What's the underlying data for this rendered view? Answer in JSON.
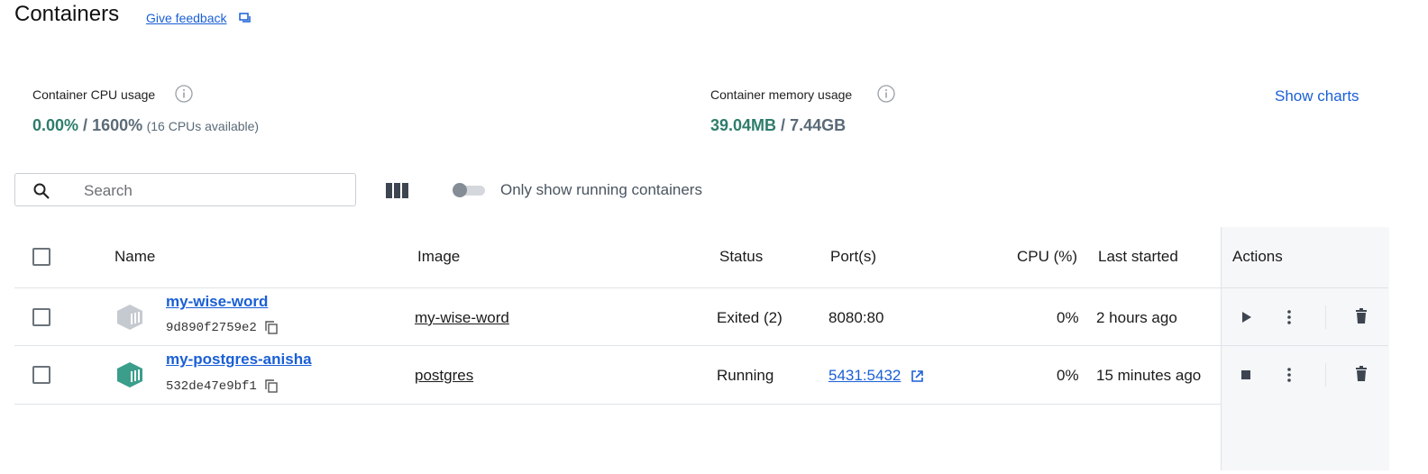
{
  "header": {
    "title": "Containers",
    "feedback_label": "Give feedback"
  },
  "stats": {
    "cpu": {
      "label": "Container CPU usage",
      "value": "0.00%",
      "separator": " / ",
      "total": "1600%",
      "note": "(16 CPUs available)"
    },
    "memory": {
      "label": "Container memory usage",
      "value": "39.04MB",
      "separator": " / ",
      "total": "7.44GB"
    },
    "show_charts_label": "Show charts"
  },
  "toolbar": {
    "search_placeholder": "Search",
    "search_value": "",
    "toggle_label": "Only show running containers",
    "toggle_on": false
  },
  "table": {
    "headers": {
      "name": "Name",
      "image": "Image",
      "status": "Status",
      "ports": "Port(s)",
      "cpu": "CPU (%)",
      "last_started": "Last started",
      "actions": "Actions"
    },
    "rows": [
      {
        "name": "my-wise-word",
        "id": "9d890f2759e2",
        "image": "my-wise-word",
        "status": "Exited (2)",
        "ports": "8080:80",
        "ports_link": false,
        "cpu": "0%",
        "last_started": "2 hours ago",
        "icon_color": "#c5cad0",
        "primary_action": "play-icon"
      },
      {
        "name": "my-postgres-anisha",
        "id": "532de47e9bf1",
        "image": "postgres",
        "status": "Running",
        "ports": "5431:5432",
        "ports_link": true,
        "cpu": "0%",
        "last_started": "15 minutes ago",
        "icon_color": "#3a9e8b",
        "primary_action": "stop-icon"
      }
    ]
  },
  "colors": {
    "accent": "#1a5fd6",
    "value_green": "#2e7d6b",
    "muted": "#5a6a78"
  }
}
